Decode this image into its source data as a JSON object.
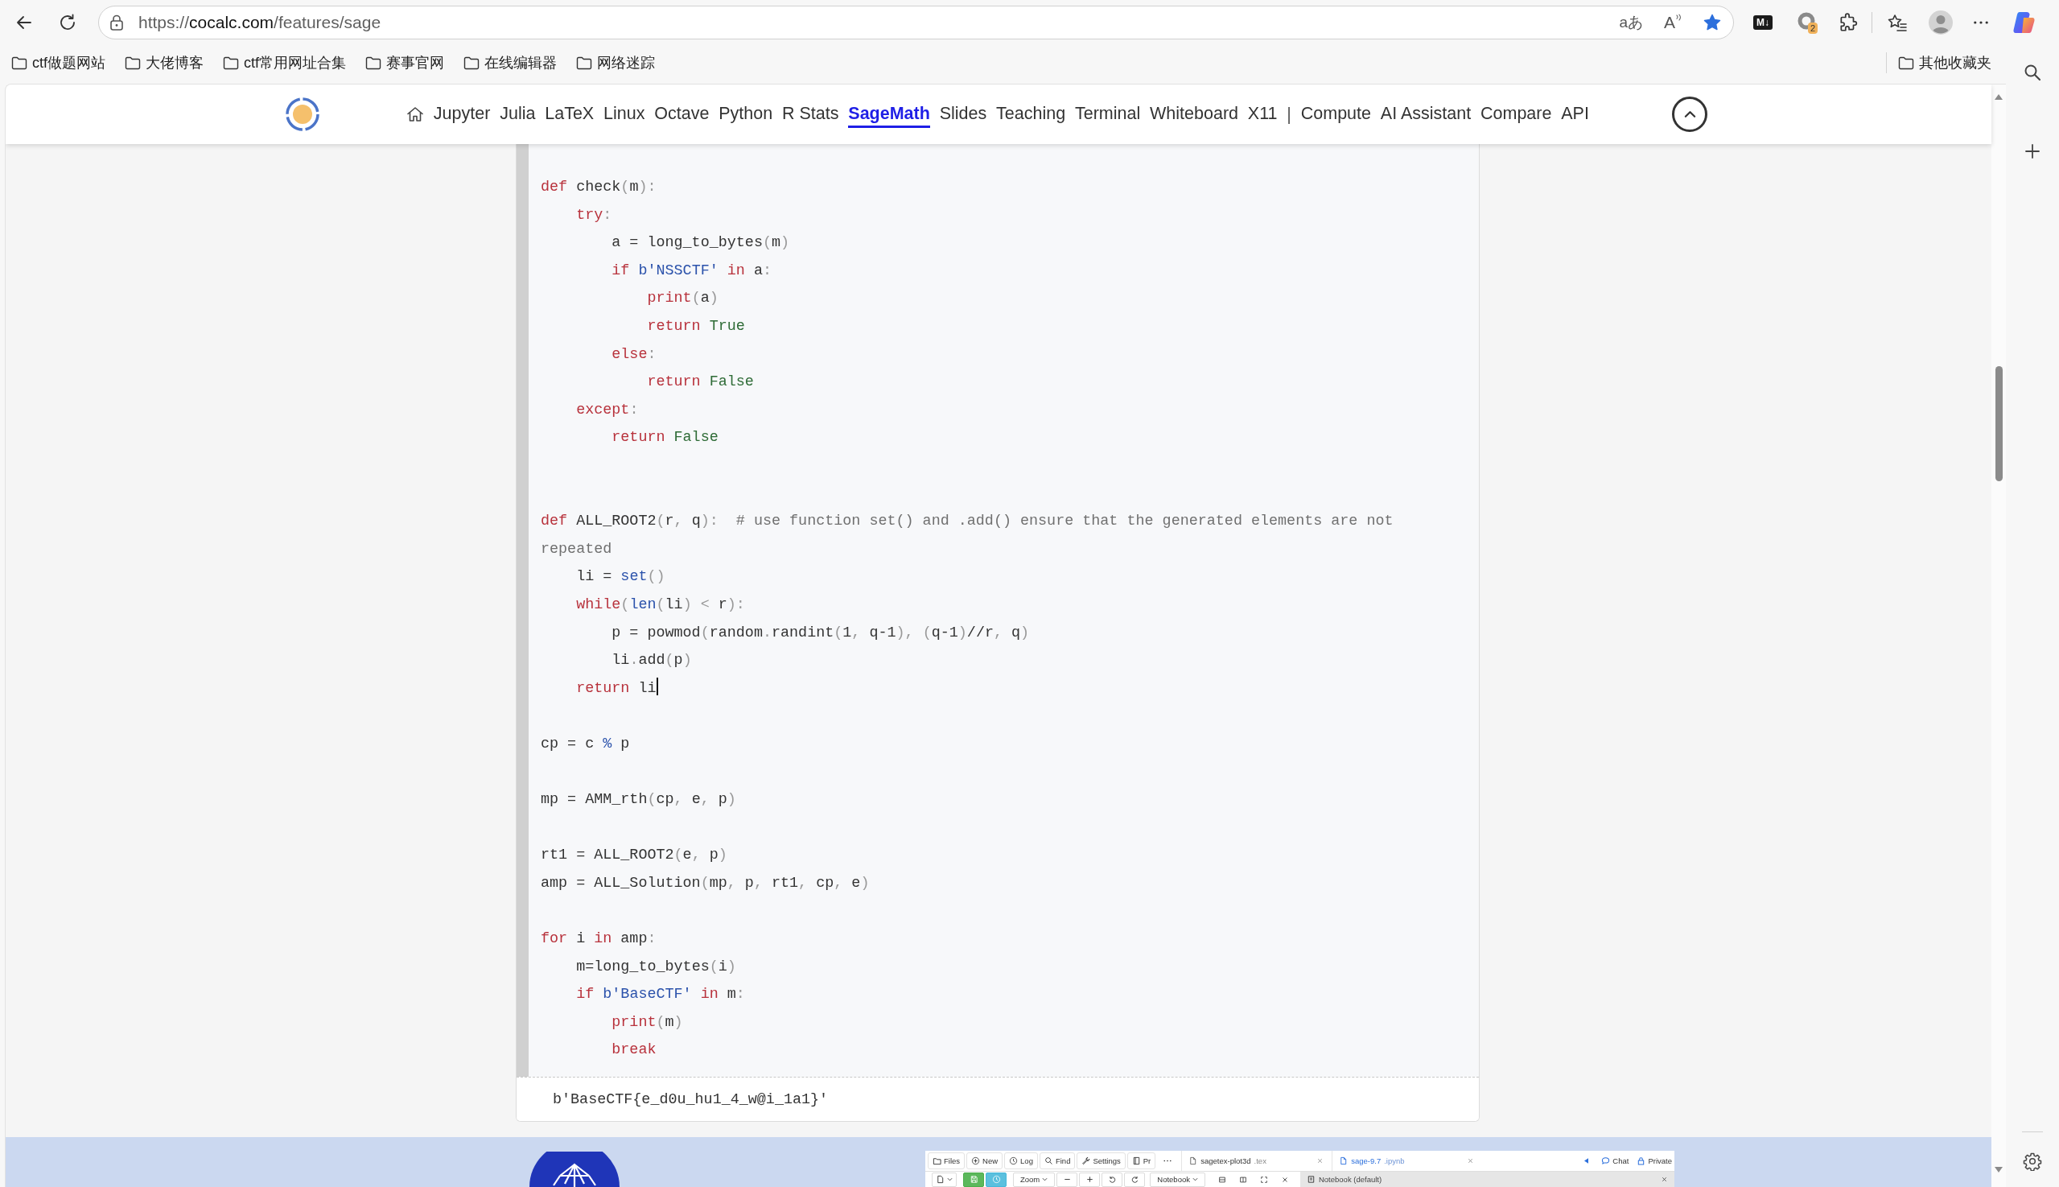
{
  "browser": {
    "address_bar": {
      "scheme": "https://",
      "host": "cocalc.com",
      "path": "/features/sage",
      "translate_glyph": "aあ",
      "read_aloud_glyph": "A",
      "favorite": true
    },
    "extensions": {
      "markdown_glyph": "M↓",
      "badge": "2"
    },
    "bookmarks": [
      {
        "label": "ctf做题网站"
      },
      {
        "label": "大佬博客"
      },
      {
        "label": "ctf常用网址合集"
      },
      {
        "label": "赛事官网"
      },
      {
        "label": "在线编辑器"
      },
      {
        "label": "网络迷踪"
      }
    ],
    "other_bookmarks": "其他收藏夹"
  },
  "header": {
    "nav": [
      {
        "kind": "home",
        "selected": false
      },
      {
        "kind": "link",
        "label": "Jupyter",
        "selected": false
      },
      {
        "kind": "link",
        "label": "Julia",
        "selected": false
      },
      {
        "kind": "link",
        "label": "LaTeX",
        "selected": false
      },
      {
        "kind": "link",
        "label": "Linux",
        "selected": false
      },
      {
        "kind": "link",
        "label": "Octave",
        "selected": false
      },
      {
        "kind": "link",
        "label": "Python",
        "selected": false
      },
      {
        "kind": "link",
        "label": "R Stats",
        "selected": false
      },
      {
        "kind": "link",
        "label": "SageMath",
        "selected": true
      },
      {
        "kind": "link",
        "label": "Slides",
        "selected": false
      },
      {
        "kind": "link",
        "label": "Teaching",
        "selected": false
      },
      {
        "kind": "link",
        "label": "Terminal",
        "selected": false
      },
      {
        "kind": "link",
        "label": "Whiteboard",
        "selected": false
      },
      {
        "kind": "link",
        "label": "X11",
        "selected": false
      },
      {
        "kind": "separator",
        "label": "|",
        "selected": false
      },
      {
        "kind": "link",
        "label": "Compute",
        "selected": false
      },
      {
        "kind": "link",
        "label": "AI Assistant",
        "selected": false
      },
      {
        "kind": "link",
        "label": "Compare",
        "selected": false
      },
      {
        "kind": "link",
        "label": "API",
        "selected": false
      }
    ]
  },
  "code_cell": {
    "lines": [
      {
        "kind": "code",
        "cursor": false,
        "segments": [
          {
            "text": "def",
            "kind": "keyword"
          },
          {
            "text": " check",
            "kind": "name"
          },
          {
            "text": "(",
            "kind": "punct"
          },
          {
            "text": "m",
            "kind": "name"
          },
          {
            "text": "):",
            "kind": "punct"
          }
        ]
      },
      {
        "kind": "code",
        "cursor": false,
        "segments": [
          {
            "text": "    try",
            "kind": "keyword"
          },
          {
            "text": ":",
            "kind": "punct"
          }
        ]
      },
      {
        "kind": "code",
        "cursor": false,
        "segments": [
          {
            "text": "        a = long_to_bytes",
            "kind": "name"
          },
          {
            "text": "(",
            "kind": "punct"
          },
          {
            "text": "m",
            "kind": "name"
          },
          {
            "text": ")",
            "kind": "punct"
          }
        ]
      },
      {
        "kind": "code",
        "cursor": false,
        "segments": [
          {
            "text": "        if",
            "kind": "keyword"
          },
          {
            "text": " b'NSSCTF'",
            "kind": "string"
          },
          {
            "text": " in",
            "kind": "keyword"
          },
          {
            "text": " a",
            "kind": "name"
          },
          {
            "text": ":",
            "kind": "punct"
          }
        ]
      },
      {
        "kind": "code",
        "cursor": false,
        "segments": [
          {
            "text": "            print",
            "kind": "keyword"
          },
          {
            "text": "(",
            "kind": "punct"
          },
          {
            "text": "a",
            "kind": "name"
          },
          {
            "text": ")",
            "kind": "punct"
          }
        ]
      },
      {
        "kind": "code",
        "cursor": false,
        "segments": [
          {
            "text": "            return",
            "kind": "keyword"
          },
          {
            "text": " True",
            "kind": "constant"
          }
        ]
      },
      {
        "kind": "code",
        "cursor": false,
        "segments": [
          {
            "text": "        else",
            "kind": "keyword"
          },
          {
            "text": ":",
            "kind": "punct"
          }
        ]
      },
      {
        "kind": "code",
        "cursor": false,
        "segments": [
          {
            "text": "            return",
            "kind": "keyword"
          },
          {
            "text": " False",
            "kind": "constant"
          }
        ]
      },
      {
        "kind": "code",
        "cursor": false,
        "segments": [
          {
            "text": "    except",
            "kind": "keyword"
          },
          {
            "text": ":",
            "kind": "punct"
          }
        ]
      },
      {
        "kind": "code",
        "cursor": false,
        "segments": [
          {
            "text": "        return",
            "kind": "keyword"
          },
          {
            "text": " False",
            "kind": "constant"
          }
        ]
      },
      {
        "kind": "blank"
      },
      {
        "kind": "blank"
      },
      {
        "kind": "code",
        "cursor": false,
        "segments": [
          {
            "text": "def",
            "kind": "keyword"
          },
          {
            "text": " ALL_ROOT2",
            "kind": "name"
          },
          {
            "text": "(",
            "kind": "punct"
          },
          {
            "text": "r",
            "kind": "name"
          },
          {
            "text": ", ",
            "kind": "punct"
          },
          {
            "text": "q",
            "kind": "name"
          },
          {
            "text": "):",
            "kind": "punct"
          },
          {
            "text": "  # use function set() and .add() ensure that the generated elements are not repeated",
            "kind": "comment"
          }
        ]
      },
      {
        "kind": "code",
        "cursor": false,
        "segments": [
          {
            "text": "    li = ",
            "kind": "name"
          },
          {
            "text": "set",
            "kind": "builtin"
          },
          {
            "text": "()",
            "kind": "punct"
          }
        ]
      },
      {
        "kind": "code",
        "cursor": false,
        "segments": [
          {
            "text": "    while",
            "kind": "keyword"
          },
          {
            "text": "(",
            "kind": "punct"
          },
          {
            "text": "len",
            "kind": "builtin"
          },
          {
            "text": "(",
            "kind": "punct"
          },
          {
            "text": "li",
            "kind": "name"
          },
          {
            "text": ") < ",
            "kind": "punct"
          },
          {
            "text": "r",
            "kind": "name"
          },
          {
            "text": "):",
            "kind": "punct"
          }
        ]
      },
      {
        "kind": "code",
        "cursor": false,
        "segments": [
          {
            "text": "        p = powmod",
            "kind": "name"
          },
          {
            "text": "(",
            "kind": "punct"
          },
          {
            "text": "random",
            "kind": "name"
          },
          {
            "text": ".",
            "kind": "punct"
          },
          {
            "text": "randint",
            "kind": "name"
          },
          {
            "text": "(",
            "kind": "punct"
          },
          {
            "text": "1",
            "kind": "name"
          },
          {
            "text": ", ",
            "kind": "punct"
          },
          {
            "text": "q-1",
            "kind": "name"
          },
          {
            "text": "), (",
            "kind": "punct"
          },
          {
            "text": "q-1",
            "kind": "name"
          },
          {
            "text": ")",
            "kind": "punct"
          },
          {
            "text": "//r",
            "kind": "name"
          },
          {
            "text": ", ",
            "kind": "punct"
          },
          {
            "text": "q",
            "kind": "name"
          },
          {
            "text": ")",
            "kind": "punct"
          }
        ]
      },
      {
        "kind": "code",
        "cursor": false,
        "segments": [
          {
            "text": "        li",
            "kind": "name"
          },
          {
            "text": ".",
            "kind": "punct"
          },
          {
            "text": "add",
            "kind": "name"
          },
          {
            "text": "(",
            "kind": "punct"
          },
          {
            "text": "p",
            "kind": "name"
          },
          {
            "text": ")",
            "kind": "punct"
          }
        ]
      },
      {
        "kind": "code",
        "cursor": true,
        "segments": [
          {
            "text": "    return",
            "kind": "keyword"
          },
          {
            "text": " li",
            "kind": "name"
          }
        ]
      },
      {
        "kind": "blank"
      },
      {
        "kind": "code",
        "cursor": false,
        "segments": [
          {
            "text": "cp = c ",
            "kind": "name"
          },
          {
            "text": "%",
            "kind": "operator"
          },
          {
            "text": " p",
            "kind": "name"
          }
        ]
      },
      {
        "kind": "blank"
      },
      {
        "kind": "code",
        "cursor": false,
        "segments": [
          {
            "text": "mp = AMM_rth",
            "kind": "name"
          },
          {
            "text": "(",
            "kind": "punct"
          },
          {
            "text": "cp",
            "kind": "name"
          },
          {
            "text": ", ",
            "kind": "punct"
          },
          {
            "text": "e",
            "kind": "name"
          },
          {
            "text": ", ",
            "kind": "punct"
          },
          {
            "text": "p",
            "kind": "name"
          },
          {
            "text": ")",
            "kind": "punct"
          }
        ]
      },
      {
        "kind": "blank"
      },
      {
        "kind": "code",
        "cursor": false,
        "segments": [
          {
            "text": "rt1 = ALL_ROOT2",
            "kind": "name"
          },
          {
            "text": "(",
            "kind": "punct"
          },
          {
            "text": "e",
            "kind": "name"
          },
          {
            "text": ", ",
            "kind": "punct"
          },
          {
            "text": "p",
            "kind": "name"
          },
          {
            "text": ")",
            "kind": "punct"
          }
        ]
      },
      {
        "kind": "code",
        "cursor": false,
        "segments": [
          {
            "text": "amp = ALL_Solution",
            "kind": "name"
          },
          {
            "text": "(",
            "kind": "punct"
          },
          {
            "text": "mp",
            "kind": "name"
          },
          {
            "text": ", ",
            "kind": "punct"
          },
          {
            "text": "p",
            "kind": "name"
          },
          {
            "text": ", ",
            "kind": "punct"
          },
          {
            "text": "rt1",
            "kind": "name"
          },
          {
            "text": ", ",
            "kind": "punct"
          },
          {
            "text": "cp",
            "kind": "name"
          },
          {
            "text": ", ",
            "kind": "punct"
          },
          {
            "text": "e",
            "kind": "name"
          },
          {
            "text": ")",
            "kind": "punct"
          }
        ]
      },
      {
        "kind": "blank"
      },
      {
        "kind": "code",
        "cursor": false,
        "segments": [
          {
            "text": "for",
            "kind": "keyword"
          },
          {
            "text": " i ",
            "kind": "name"
          },
          {
            "text": "in",
            "kind": "keyword"
          },
          {
            "text": " amp",
            "kind": "name"
          },
          {
            "text": ":",
            "kind": "punct"
          }
        ]
      },
      {
        "kind": "code",
        "cursor": false,
        "segments": [
          {
            "text": "    m=long_to_bytes",
            "kind": "name"
          },
          {
            "text": "(",
            "kind": "punct"
          },
          {
            "text": "i",
            "kind": "name"
          },
          {
            "text": ")",
            "kind": "punct"
          }
        ]
      },
      {
        "kind": "code",
        "cursor": false,
        "segments": [
          {
            "text": "    if",
            "kind": "keyword"
          },
          {
            "text": " b'BaseCTF'",
            "kind": "string"
          },
          {
            "text": " in",
            "kind": "keyword"
          },
          {
            "text": " m",
            "kind": "name"
          },
          {
            "text": ":",
            "kind": "punct"
          }
        ]
      },
      {
        "kind": "code",
        "cursor": false,
        "segments": [
          {
            "text": "        print",
            "kind": "keyword"
          },
          {
            "text": "(",
            "kind": "punct"
          },
          {
            "text": "m",
            "kind": "name"
          },
          {
            "text": ")",
            "kind": "punct"
          }
        ]
      },
      {
        "kind": "code",
        "cursor": false,
        "segments": [
          {
            "text": "        break",
            "kind": "keyword"
          }
        ]
      }
    ],
    "output": "b'BaseCTF{e_d0u_hu1_4_w@i_1a1}'"
  },
  "preview": {
    "toolbar": [
      {
        "label": "Files"
      },
      {
        "label": "New"
      },
      {
        "label": "Log"
      },
      {
        "label": "Find"
      },
      {
        "label": "Settings"
      },
      {
        "label": "Pr"
      }
    ],
    "tabs": [
      {
        "name": "sagetex-plot3d",
        "ext": ".tex",
        "selected": false
      },
      {
        "name": "sage-9.7",
        "ext": ".ipynb",
        "selected": true
      }
    ],
    "actions": [
      {
        "label": "Chat"
      },
      {
        "label": "Private"
      }
    ],
    "edit_bar": [
      {
        "label": "Zoom"
      },
      {
        "label": "Notebook"
      }
    ],
    "kernel": "Notebook (default)"
  }
}
